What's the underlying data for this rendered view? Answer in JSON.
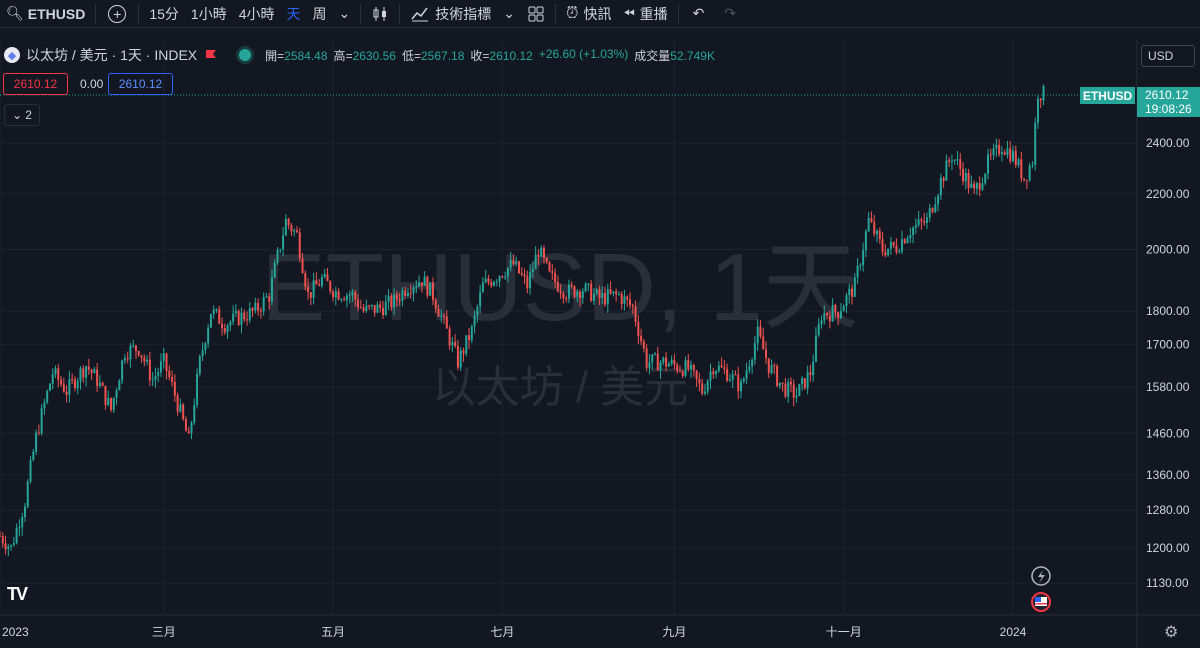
{
  "toolbar": {
    "symbol": "ETHUSD",
    "add_icon": "plus-circle-icon",
    "intervals": [
      "15分",
      "1小時",
      "4小時",
      "天",
      "周"
    ],
    "active_interval": "天",
    "indicators_label": "技術指標",
    "alert_label": "快訊",
    "replay_label": "重播"
  },
  "legend": {
    "title": "以太坊 / 美元 · 1天 · INDEX",
    "open_label": "開",
    "open": "2584.48",
    "high_label": "高",
    "high": "2630.56",
    "low_label": "低",
    "low": "2567.18",
    "close_label": "收",
    "close": "2610.12",
    "change": "+26.60 (+1.03%)",
    "volume_label": "成交量",
    "volume": "52.749K"
  },
  "price_boxes": {
    "bid": "2610.12",
    "spread": "0.00",
    "ask": "2610.12"
  },
  "collapse_count": "2",
  "currency": "USD",
  "last_price": {
    "symbol": "ETHUSD",
    "price": "2610.12",
    "countdown": "19:08:26"
  },
  "watermark": {
    "line1": "ETHUSD, 1天",
    "line2": "以太坊 / 美元"
  },
  "colors": {
    "up": "#26a69a",
    "down": "#ef5350",
    "bg": "#131722",
    "grid": "#1e222d",
    "accent": "#2962ff"
  },
  "chart_data": {
    "type": "candlestick",
    "scale": "log",
    "y_ticks": [
      1130,
      1200,
      1280,
      1360,
      1460,
      1580,
      1700,
      1800,
      2000,
      2200,
      2400
    ],
    "y_tick_labels": [
      "1130.00",
      "1200.00",
      "1280.00",
      "1360.00",
      "1460.00",
      "1580.00",
      "1700.00",
      "1800.00",
      "2000.00",
      "2200.00",
      "2400.00"
    ],
    "x_labels": [
      "2023",
      "三月",
      "五月",
      "七月",
      "九月",
      "十一月",
      "2024"
    ],
    "series": [
      {
        "values": [
          [
            "2023-01-01",
            1225
          ],
          [
            "2023-01-05",
            1200
          ],
          [
            "2023-01-10",
            1300
          ],
          [
            "2023-01-14",
            1450
          ],
          [
            "2023-01-20",
            1620
          ],
          [
            "2023-01-25",
            1570
          ],
          [
            "2023-02-01",
            1640
          ],
          [
            "2023-02-05",
            1600
          ],
          [
            "2023-02-10",
            1520
          ],
          [
            "2023-02-15",
            1680
          ],
          [
            "2023-02-20",
            1690
          ],
          [
            "2023-02-25",
            1600
          ],
          [
            "2023-03-01",
            1650
          ],
          [
            "2023-03-05",
            1560
          ],
          [
            "2023-03-10",
            1440
          ],
          [
            "2023-03-14",
            1650
          ],
          [
            "2023-03-18",
            1800
          ],
          [
            "2023-03-23",
            1760
          ],
          [
            "2023-03-28",
            1780
          ],
          [
            "2023-04-03",
            1800
          ],
          [
            "2023-04-08",
            1850
          ],
          [
            "2023-04-14",
            2100
          ],
          [
            "2023-04-18",
            2050
          ],
          [
            "2023-04-22",
            1850
          ],
          [
            "2023-04-27",
            1900
          ],
          [
            "2023-05-02",
            1860
          ],
          [
            "2023-05-08",
            1850
          ],
          [
            "2023-05-12",
            1800
          ],
          [
            "2023-05-18",
            1810
          ],
          [
            "2023-05-23",
            1830
          ],
          [
            "2023-05-28",
            1880
          ],
          [
            "2023-06-02",
            1900
          ],
          [
            "2023-06-06",
            1850
          ],
          [
            "2023-06-10",
            1760
          ],
          [
            "2023-06-15",
            1650
          ],
          [
            "2023-06-20",
            1740
          ],
          [
            "2023-06-24",
            1880
          ],
          [
            "2023-06-30",
            1920
          ],
          [
            "2023-07-05",
            1950
          ],
          [
            "2023-07-10",
            1880
          ],
          [
            "2023-07-14",
            2000
          ],
          [
            "2023-07-18",
            1910
          ],
          [
            "2023-07-24",
            1860
          ],
          [
            "2023-07-30",
            1870
          ],
          [
            "2023-08-05",
            1840
          ],
          [
            "2023-08-12",
            1850
          ],
          [
            "2023-08-17",
            1810
          ],
          [
            "2023-08-22",
            1650
          ],
          [
            "2023-08-28",
            1650
          ],
          [
            "2023-09-01",
            1640
          ],
          [
            "2023-09-06",
            1630
          ],
          [
            "2023-09-11",
            1570
          ],
          [
            "2023-09-15",
            1640
          ],
          [
            "2023-09-20",
            1620
          ],
          [
            "2023-09-25",
            1580
          ],
          [
            "2023-10-01",
            1730
          ],
          [
            "2023-10-05",
            1640
          ],
          [
            "2023-10-10",
            1580
          ],
          [
            "2023-10-15",
            1560
          ],
          [
            "2023-10-20",
            1620
          ],
          [
            "2023-10-24",
            1790
          ],
          [
            "2023-10-30",
            1800
          ],
          [
            "2023-11-05",
            1880
          ],
          [
            "2023-11-10",
            2100
          ],
          [
            "2023-11-15",
            2000
          ],
          [
            "2023-11-20",
            2010
          ],
          [
            "2023-11-25",
            2070
          ],
          [
            "2023-12-01",
            2100
          ],
          [
            "2023-12-06",
            2250
          ],
          [
            "2023-12-10",
            2350
          ],
          [
            "2023-12-14",
            2280
          ],
          [
            "2023-12-18",
            2200
          ],
          [
            "2023-12-23",
            2320
          ],
          [
            "2023-12-28",
            2390
          ],
          [
            "2024-01-01",
            2350
          ],
          [
            "2024-01-05",
            2260
          ],
          [
            "2024-01-08",
            2330
          ],
          [
            "2024-01-10",
            2620
          ],
          [
            "2024-01-12",
            2610
          ]
        ]
      }
    ]
  }
}
